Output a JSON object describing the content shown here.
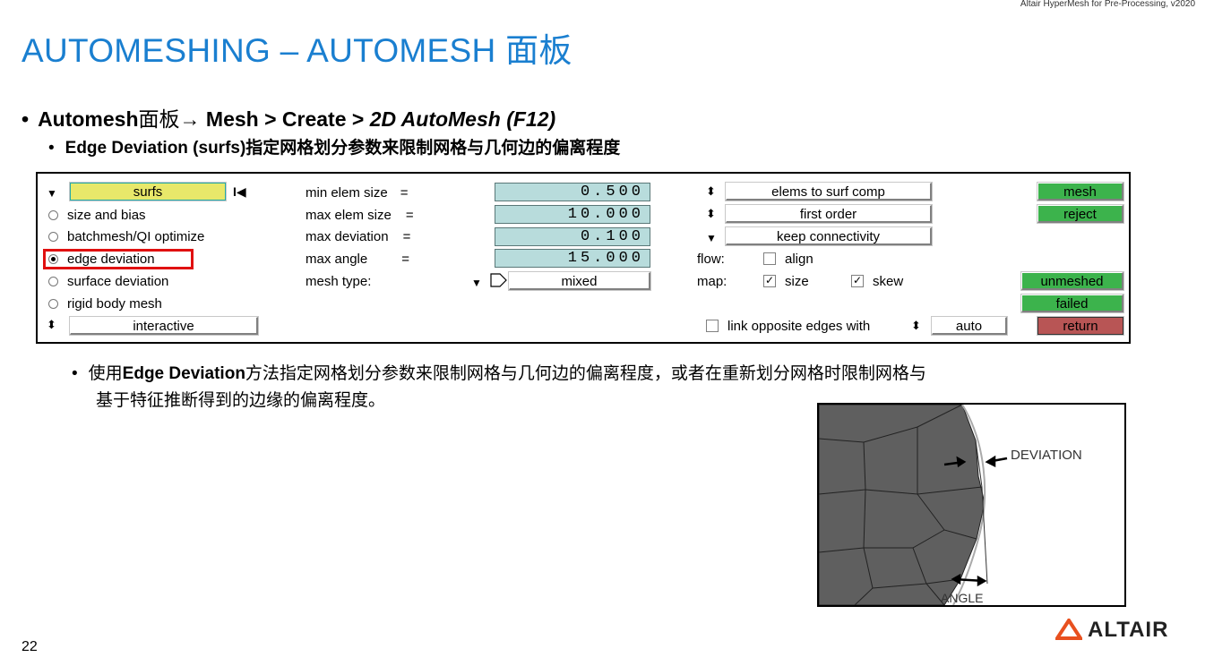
{
  "header": {
    "product_line": "Altair HyperMesh for Pre-Processing, v2020"
  },
  "slide": {
    "title": "AUTOMESHING – AUTOMESH 面板",
    "bullet1": {
      "prefix": "Automesh",
      "cn": "面板",
      "arrow": "→",
      "path": "Mesh > Create > ",
      "italic": "2D AutoMesh (F12)"
    },
    "bullet2": "Edge Deviation (surfs)指定网格划分参数来限制网格与几何边的偏离程度",
    "paragraph_line1_pre": "使用",
    "paragraph_line1_bold": "Edge Deviation",
    "paragraph_line1_post": "方法指定网格划分参数来限制网格与几何边的偏离程度，或者在重新划分网格时限制网格与",
    "paragraph_line2": "基于特征推断得到的边缘的偏离程度。",
    "page_number": "22",
    "logo_text": "ALTAIR"
  },
  "panel": {
    "entity_selector": "surfs",
    "radio_options": [
      {
        "label": "size and bias",
        "selected": false
      },
      {
        "label": "batchmesh/QI optimize",
        "selected": false
      },
      {
        "label": "edge deviation",
        "selected": true
      },
      {
        "label": "surface deviation",
        "selected": false
      },
      {
        "label": "rigid body mesh",
        "selected": false
      }
    ],
    "mode_toggle": "interactive",
    "params": [
      {
        "label": "min elem size",
        "eq": "=",
        "value": "0.500"
      },
      {
        "label": "max elem size",
        "eq": "=",
        "value": "10.000"
      },
      {
        "label": "max deviation",
        "eq": "=",
        "value": "0.100"
      },
      {
        "label": "max angle",
        "eq": "=",
        "value": "15.000"
      }
    ],
    "mesh_type_label": "mesh type:",
    "mesh_type_value": "mixed",
    "options": [
      "elems to surf comp",
      "first order",
      "keep connectivity"
    ],
    "flow_label": "flow:",
    "align_label": "align",
    "map_label": "map:",
    "size_label": "size",
    "skew_label": "skew",
    "link_label": "link opposite edges with",
    "auto_label": "auto",
    "action_buttons": {
      "mesh": "mesh",
      "reject": "reject",
      "unmeshed": "unmeshed",
      "failed": "failed",
      "return": "return"
    }
  },
  "figure": {
    "deviation_label": "DEVIATION",
    "angle_label": "ANGLE"
  },
  "colors": {
    "title": "#1a7fd0",
    "green_button": "#3cb34c",
    "return_button": "#b85555",
    "entity_field": "#e8e86a",
    "value_field": "#b8dcdc",
    "highlight": "#e01010"
  }
}
